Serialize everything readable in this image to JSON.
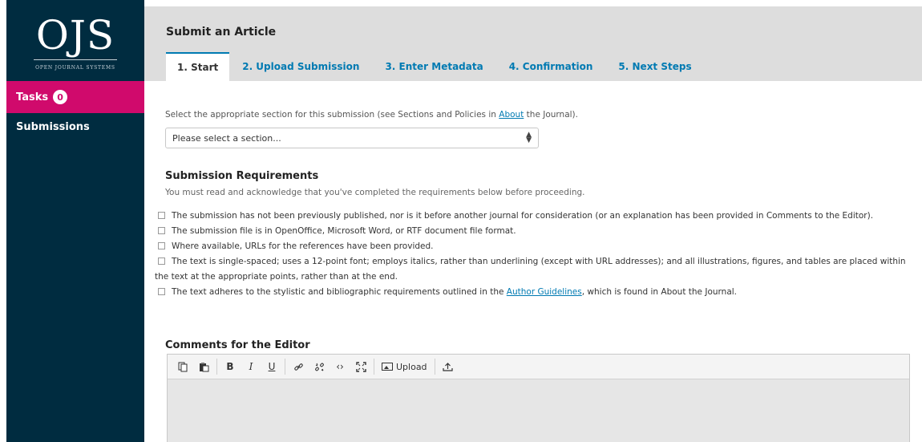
{
  "logo": {
    "mark": "OJS",
    "subtitle": "OPEN JOURNAL SYSTEMS"
  },
  "sidebar": {
    "tasks_label": "Tasks",
    "tasks_count": "0",
    "submissions_label": "Submissions"
  },
  "header": {
    "title": "Submit an Article",
    "tabs": [
      {
        "label": "1. Start"
      },
      {
        "label": "2. Upload Submission"
      },
      {
        "label": "3. Enter Metadata"
      },
      {
        "label": "4. Confirmation"
      },
      {
        "label": "5. Next Steps"
      }
    ]
  },
  "section": {
    "help_before": "Select the appropriate section for this submission (see Sections and Policies in ",
    "help_link": "About",
    "help_after": " the Journal).",
    "select_value": "Please select a section..."
  },
  "requirements": {
    "title": "Submission Requirements",
    "help": "You must read and acknowledge that you've completed the requirements below before proceeding.",
    "items": [
      {
        "text": "The submission has not been previously published, nor is it before another journal for consideration (or an explanation has been provided in Comments to the Editor)."
      },
      {
        "text": "The submission file is in OpenOffice, Microsoft Word, or RTF document file format."
      },
      {
        "text": "Where available, URLs for the references have been provided."
      },
      {
        "text": "The text is single-spaced; uses a 12-point font; employs italics, rather than underlining (except with URL addresses); and all illustrations, figures, and tables are placed within the text at the appropriate points, rather than at the end."
      },
      {
        "text_before": "The text adheres to the stylistic and bibliographic requirements outlined in the ",
        "link": "Author Guidelines",
        "text_after": ", which is found in About the Journal."
      }
    ]
  },
  "comments": {
    "title": "Comments for the Editor",
    "toolbar": {
      "bold": "B",
      "italic": "I",
      "underline": "U",
      "code": "‹›",
      "upload_label": "Upload"
    }
  },
  "colors": {
    "sidebar": "#002c40",
    "tasks_bg": "#d00a6c",
    "link": "#007ab2",
    "header_bg": "#dddddd"
  },
  "icons": [
    "copy-icon",
    "paste-icon",
    "link-icon",
    "unlink-icon",
    "code-icon",
    "fullscreen-icon",
    "image-icon",
    "upload-file-icon",
    "select-arrows-icon"
  ]
}
